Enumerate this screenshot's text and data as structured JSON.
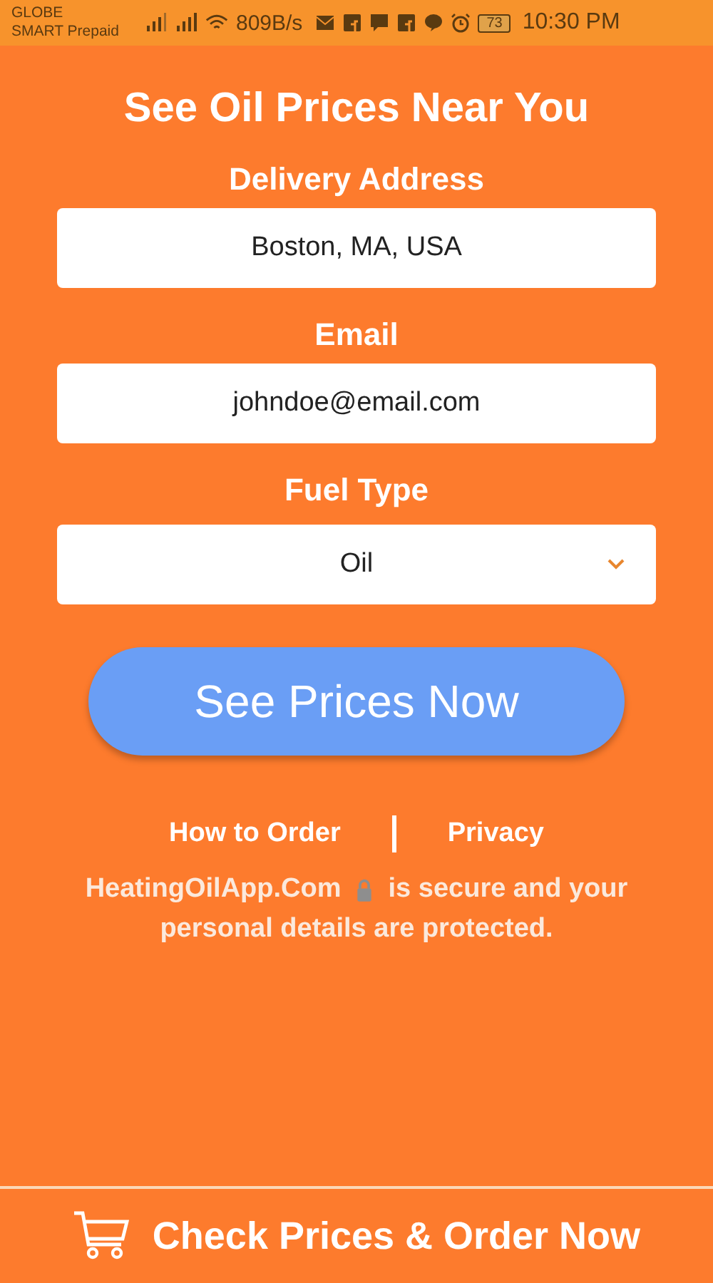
{
  "status_bar": {
    "carrier": [
      "GLOBE",
      "SMART Prepaid"
    ],
    "speed": "809B/s",
    "battery": "73",
    "time": "10:30 PM"
  },
  "title": "See Oil Prices Near You",
  "fields": [
    {
      "kind": "text",
      "label": "Delivery Address",
      "value": "Boston, MA, USA"
    },
    {
      "kind": "text",
      "label": "Email",
      "value": "johndoe@email.com"
    },
    {
      "kind": "select",
      "label": "Fuel Type",
      "value": "Oil"
    }
  ],
  "submit": "See Prices Now",
  "links": [
    "How to Order",
    "Privacy"
  ],
  "secure_note": {
    "site": "HeatingOilApp.Com",
    "lines": [
      "is secure and your",
      "personal details are protected."
    ]
  },
  "footer_button": "Check Prices & Order Now"
}
